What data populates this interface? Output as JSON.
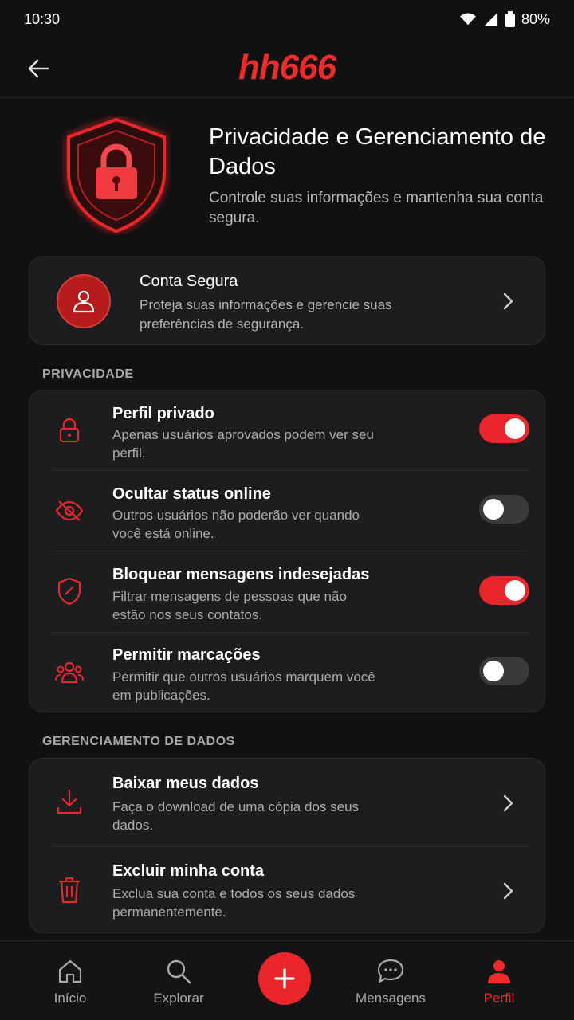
{
  "status_bar": {
    "time": "10:30",
    "battery": "80%"
  },
  "header": {
    "logo": "hh666",
    "back_icon": "arrow-left-icon"
  },
  "hero": {
    "title": "Privacidade e Gerenciamento de Dados",
    "subtitle": "Controle suas informações e mantenha sua conta segura.",
    "icon": "shield-lock-icon"
  },
  "secure_account": {
    "title": "Conta Segura",
    "description": "Proteja suas informações e gerencie suas preferências de segurança.",
    "icon": "user-icon"
  },
  "privacy": {
    "section_label": "PRIVACIDADE",
    "items": [
      {
        "title": "Perfil privado",
        "description": "Apenas usuários aprovados podem ver seu perfil.",
        "icon": "lock-icon",
        "enabled": true
      },
      {
        "title": "Ocultar status online",
        "description": "Outros usuários não poderão ver quando você está online.",
        "icon": "eye-off-icon",
        "enabled": false
      },
      {
        "title": "Bloquear mensagens indesejadas",
        "description": "Filtrar mensagens de pessoas que não estão nos seus contatos.",
        "icon": "shield-icon",
        "enabled": true
      },
      {
        "title": "Permitir marcações",
        "description": "Permitir que outros usuários marquem você em publicações.",
        "icon": "users-icon",
        "enabled": false
      }
    ]
  },
  "data_management": {
    "section_label": "GERENCIAMENTO DE DADOS",
    "items": [
      {
        "title": "Baixar meus dados",
        "description": "Faça o download de uma cópia dos seus dados.",
        "icon": "download-icon"
      },
      {
        "title": "Excluir minha conta",
        "description": "Exclua sua conta e todos os seus dados permanentemente.",
        "icon": "trash-icon"
      }
    ]
  },
  "bottom_nav": {
    "items": [
      {
        "label": "Início",
        "icon": "home-icon"
      },
      {
        "label": "Explorar",
        "icon": "search-icon"
      },
      {
        "label": "Mensagens",
        "icon": "chat-icon"
      },
      {
        "label": "Perfil",
        "icon": "profile-icon"
      }
    ],
    "fab_icon": "plus-icon",
    "active": "Perfil"
  },
  "colors": {
    "accent": "#e8262b",
    "background": "#111111",
    "card": "#1d1d1f"
  }
}
